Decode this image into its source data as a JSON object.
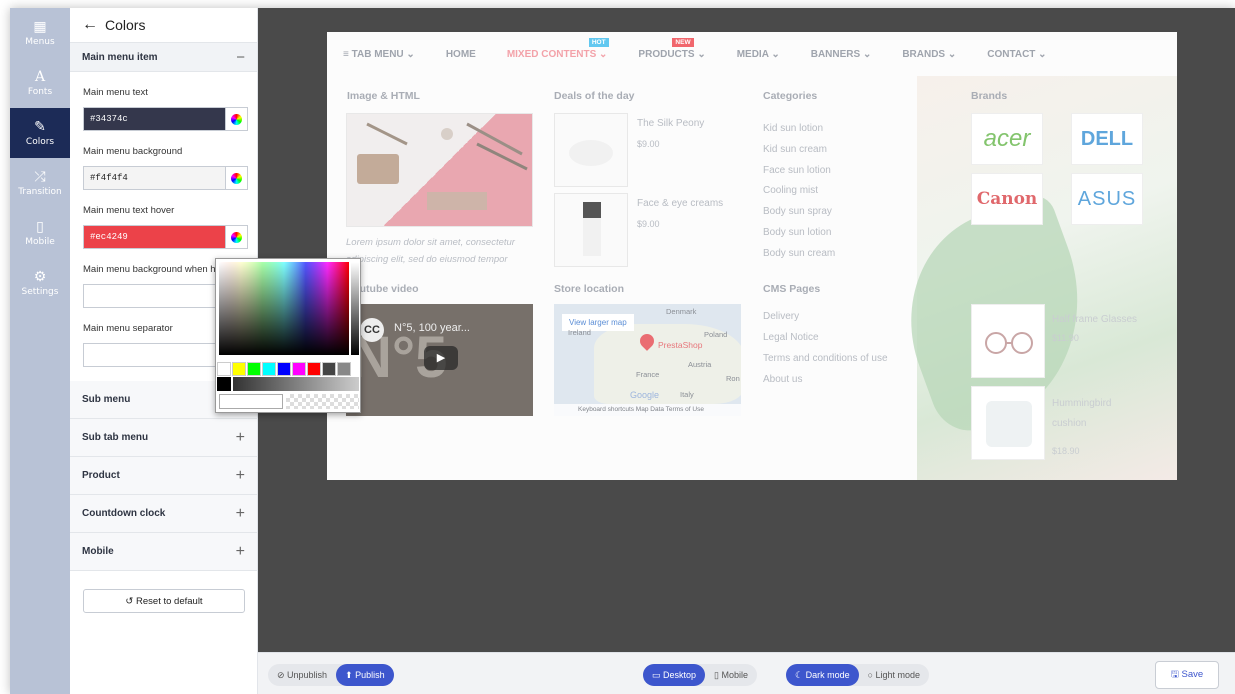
{
  "rail": {
    "items": [
      {
        "label": "Menus",
        "icon": "▦"
      },
      {
        "label": "Fonts",
        "icon": "A"
      },
      {
        "label": "Colors",
        "icon": "✎"
      },
      {
        "label": "Transition",
        "icon": "⤮"
      },
      {
        "label": "Mobile",
        "icon": "▯"
      },
      {
        "label": "Settings",
        "icon": "⚙"
      }
    ]
  },
  "panel": {
    "back_icon": "←",
    "title": "Colors",
    "section_open": {
      "label": "Main menu item",
      "toggle": "−"
    },
    "fields": [
      {
        "label": "Main menu text",
        "value": "#34374c",
        "bg": "#34374c",
        "fg": "#ffffff"
      },
      {
        "label": "Main menu background",
        "value": "#f4f4f4",
        "bg": "#f4f4f4",
        "fg": "#222222"
      },
      {
        "label": "Main menu text hover",
        "value": "#ec4249",
        "bg": "#ec4249",
        "fg": "#ffffff"
      },
      {
        "label": "Main menu background when hover",
        "value": "",
        "bg": "#ffffff",
        "fg": "#222222"
      },
      {
        "label": "Main menu separator",
        "value": "",
        "bg": "#ffffff",
        "fg": "#222222"
      }
    ],
    "collapsed_sections": [
      {
        "label": "Sub menu",
        "toggle": "+"
      },
      {
        "label": "Sub tab menu",
        "toggle": "+"
      },
      {
        "label": "Product",
        "toggle": "+"
      },
      {
        "label": "Countdown clock",
        "toggle": "+"
      },
      {
        "label": "Mobile",
        "toggle": "+"
      }
    ],
    "reset_label": "↺ Reset to default"
  },
  "color_picker": {
    "swatches": [
      "#ffffff",
      "#ffff00",
      "#00ff00",
      "#00ffff",
      "#0000ff",
      "#ff00ff",
      "#ff0000",
      "#444444",
      "#888888"
    ]
  },
  "preview": {
    "menu": [
      {
        "label": "≡ TAB MENU ⌄"
      },
      {
        "label": "HOME"
      },
      {
        "label": "MIXED CONTENTS ⌄",
        "badge": "HOT",
        "badge_color": "#62c8f0"
      },
      {
        "label": "PRODUCTS ⌄",
        "badge": "NEW",
        "badge_color": "#f1676d"
      },
      {
        "label": "MEDIA ⌄"
      },
      {
        "label": "BANNERS ⌄"
      },
      {
        "label": "BRANDS ⌄"
      },
      {
        "label": "CONTACT ⌄"
      }
    ],
    "col1_title": "Image & HTML",
    "lorem": "Lorem ipsum dolor sit amet, consectetur adipiscing elit, sed do eiusmod tempor",
    "col2_title": "Deals of the day",
    "deal1_name": "The Silk Peony",
    "deal1_price": "$9.00",
    "deal2_name": "Face & eye creams",
    "deal2_price": "$9.00",
    "col3_title": "Categories",
    "categories": [
      "Kid sun lotion",
      "Kid sun cream",
      "Face sun lotion",
      "Cooling mist",
      "Body sun spray",
      "Body sun lotion",
      "Body sun cream"
    ],
    "col4_title": "Brands",
    "brands": [
      {
        "name": "acer",
        "color": "#83c46d"
      },
      {
        "name": "DELL",
        "color": "#5fa6dc"
      },
      {
        "name": "Canon",
        "color": "#e0686c"
      },
      {
        "name": "ASUS",
        "color": "#5fa6dc"
      }
    ],
    "video_title": "Youtube video",
    "video_text": "N°5, 100 year...",
    "video_big": "N°5",
    "video_logo": "CC",
    "store_title": "Store location",
    "map_button": "View larger map",
    "map_pin_label": "PrestaShop",
    "map_labels": [
      "Denmark",
      "Poland",
      "Austria",
      "France",
      "Italy",
      "Ireland",
      "Ron"
    ],
    "map_footer": "Keyboard shortcuts   Map Data   Terms of Use",
    "map_google": "Google",
    "cms_title": "CMS Pages",
    "cms": [
      "Delivery",
      "Legal Notice",
      "Terms and conditions of use",
      "About us"
    ],
    "side_prod1_name": "Half frame Glasses",
    "side_prod1_price": "$11.90",
    "side_prod2_name": "Hummingbird cushion",
    "side_prod2_price": "$18.90"
  },
  "bottom": {
    "unpublish": "⊘ Unpublish",
    "publish": "⬆ Publish",
    "desktop": "▭ Desktop",
    "mobile": "▯ Mobile",
    "dark": "☾ Dark mode",
    "light": "○ Light mode",
    "save": "🖫 Save"
  }
}
